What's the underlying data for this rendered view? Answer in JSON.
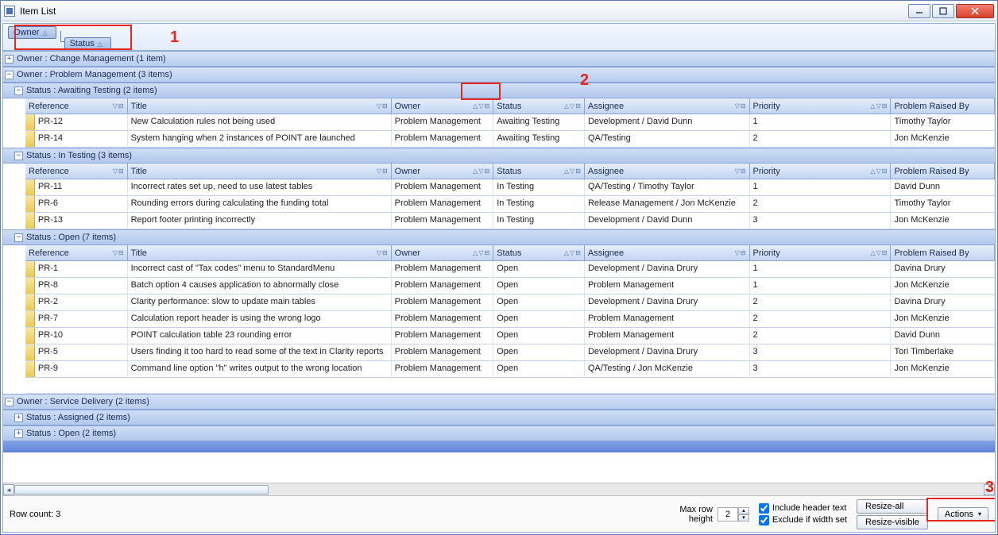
{
  "window": {
    "title": "Item List"
  },
  "groupby": {
    "chip1": "Owner",
    "chip2": "Status"
  },
  "callouts": {
    "n1": "1",
    "n2": "2",
    "n3": "3"
  },
  "groups": {
    "g0": {
      "label": "Owner : Change Management (1 item)"
    },
    "g1": {
      "label": "Owner : Problem Management (3 items)"
    },
    "g1s0": {
      "label": "Status : Awaiting Testing (2 items)"
    },
    "g1s1": {
      "label": "Status : In Testing (3 items)"
    },
    "g1s2": {
      "label": "Status : Open (7 items)"
    },
    "g2": {
      "label": "Owner : Service Delivery (2 items)"
    },
    "g2s0": {
      "label": "Status : Assigned (2 items)"
    },
    "g2s1": {
      "label": "Status : Open (2 items)"
    }
  },
  "columns": {
    "ref": "Reference",
    "title": "Title",
    "owner": "Owner",
    "status": "Status",
    "assignee": "Assignee",
    "priority": "Priority",
    "raised": "Problem Raised By"
  },
  "rows": {
    "awaiting": [
      {
        "ref": "PR-12",
        "title": "New Calculation rules not being used",
        "owner": "Problem Management",
        "status": "Awaiting Testing",
        "assignee": "Development / David Dunn",
        "priority": "1",
        "raised": "Timothy Taylor"
      },
      {
        "ref": "PR-14",
        "title": "System hanging when 2 instances of POINT are launched",
        "owner": "Problem Management",
        "status": "Awaiting Testing",
        "assignee": "QA/Testing",
        "priority": "2",
        "raised": "Jon McKenzie"
      }
    ],
    "intesting": [
      {
        "ref": "PR-11",
        "title": "Incorrect rates set up, need to use latest tables",
        "owner": "Problem Management",
        "status": "In Testing",
        "assignee": "QA/Testing / Timothy Taylor",
        "priority": "1",
        "raised": "David Dunn"
      },
      {
        "ref": "PR-6",
        "title": "Rounding errors during calculating the funding total",
        "owner": "Problem Management",
        "status": "In Testing",
        "assignee": "Release Management / Jon McKenzie",
        "priority": "2",
        "raised": "Timothy Taylor"
      },
      {
        "ref": "PR-13",
        "title": "Report footer printing incorrectly",
        "owner": "Problem Management",
        "status": "In Testing",
        "assignee": "Development / David Dunn",
        "priority": "3",
        "raised": "Jon McKenzie"
      }
    ],
    "open": [
      {
        "ref": "PR-1",
        "title": "Incorrect cast of \"Tax codes\" menu to StandardMenu",
        "owner": "Problem Management",
        "status": "Open",
        "assignee": "Development / Davina Drury",
        "priority": "1",
        "raised": "Davina Drury"
      },
      {
        "ref": "PR-8",
        "title": "Batch option 4 causes application to abnormally close",
        "owner": "Problem Management",
        "status": "Open",
        "assignee": "Problem Management",
        "priority": "1",
        "raised": "Jon McKenzie"
      },
      {
        "ref": "PR-2",
        "title": "Clarity performance: slow to update main tables",
        "owner": "Problem Management",
        "status": "Open",
        "assignee": "Development / Davina Drury",
        "priority": "2",
        "raised": "Davina Drury"
      },
      {
        "ref": "PR-7",
        "title": "Calculation report header is using the wrong logo",
        "owner": "Problem Management",
        "status": "Open",
        "assignee": "Problem Management",
        "priority": "2",
        "raised": "Jon McKenzie"
      },
      {
        "ref": "PR-10",
        "title": "POINT calculation table 23 rounding error",
        "owner": "Problem Management",
        "status": "Open",
        "assignee": "Problem Management",
        "priority": "2",
        "raised": "David Dunn"
      },
      {
        "ref": "PR-5",
        "title": "Users finding it too hard to read some of the text in Clarity reports",
        "owner": "Problem Management",
        "status": "Open",
        "assignee": "Development / Davina Drury",
        "priority": "3",
        "raised": "Tori Timberlake"
      },
      {
        "ref": "PR-9",
        "title": "Command line option \"h\" writes output to the wrong location",
        "owner": "Problem Management",
        "status": "Open",
        "assignee": "QA/Testing / Jon McKenzie",
        "priority": "3",
        "raised": "Jon McKenzie"
      }
    ]
  },
  "footer": {
    "rowcount": "Row count: 3",
    "maxrow_label": "Max row\nheight",
    "maxrow_value": "2",
    "include_header": "Include header text",
    "exclude_width": "Exclude if width set",
    "resize_all": "Resize-all",
    "resize_visible": "Resize-visible",
    "actions": "Actions"
  }
}
